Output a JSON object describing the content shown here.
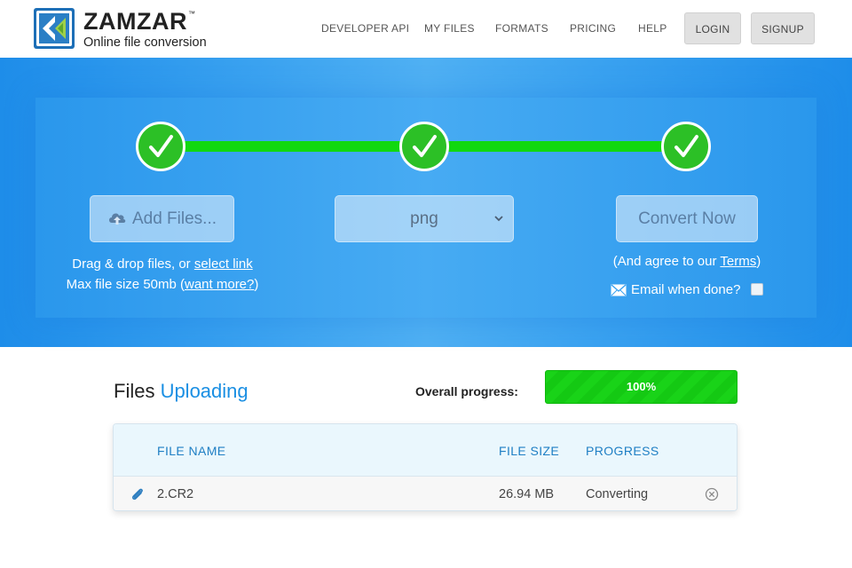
{
  "brand": {
    "name": "ZAMZAR",
    "trademark": "™",
    "tagline": "Online file conversion",
    "logo_color": "#1d6fb7"
  },
  "nav": {
    "items": [
      {
        "label": "DEVELOPER API"
      },
      {
        "label": "MY FILES"
      },
      {
        "label": "FORMATS"
      },
      {
        "label": "PRICING"
      },
      {
        "label": "HELP"
      }
    ],
    "login_label": "LOGIN",
    "signup_label": "SIGNUP"
  },
  "converter": {
    "steps_completed": 3,
    "step_color": "#2cc026",
    "add_files_label": "Add Files...",
    "add_files_icon": "cloud-upload-icon",
    "drag_text": "Drag & drop files, or ",
    "select_link": "select link",
    "max_size_text": "Max file size 50mb (",
    "want_more_link": "want more?",
    "max_size_suffix": ")",
    "format_selected": "png",
    "convert_label": "Convert Now",
    "agree_text": "(And agree to our ",
    "terms_link": "Terms",
    "agree_suffix": ")",
    "email_label": "Email when done?",
    "email_icon": "envelope-icon",
    "email_checked": false
  },
  "files": {
    "title_prefix": "Files ",
    "title_accent": "Uploading",
    "overall_label": "Overall progress:",
    "overall_progress": 100,
    "overall_text": "100%",
    "progress_color": "#19d318",
    "columns": {
      "name": "FILE NAME",
      "size": "FILE SIZE",
      "progress": "PROGRESS"
    },
    "rows": [
      {
        "name": "2.CR2",
        "size": "26.94 MB",
        "status": "Converting"
      }
    ]
  }
}
